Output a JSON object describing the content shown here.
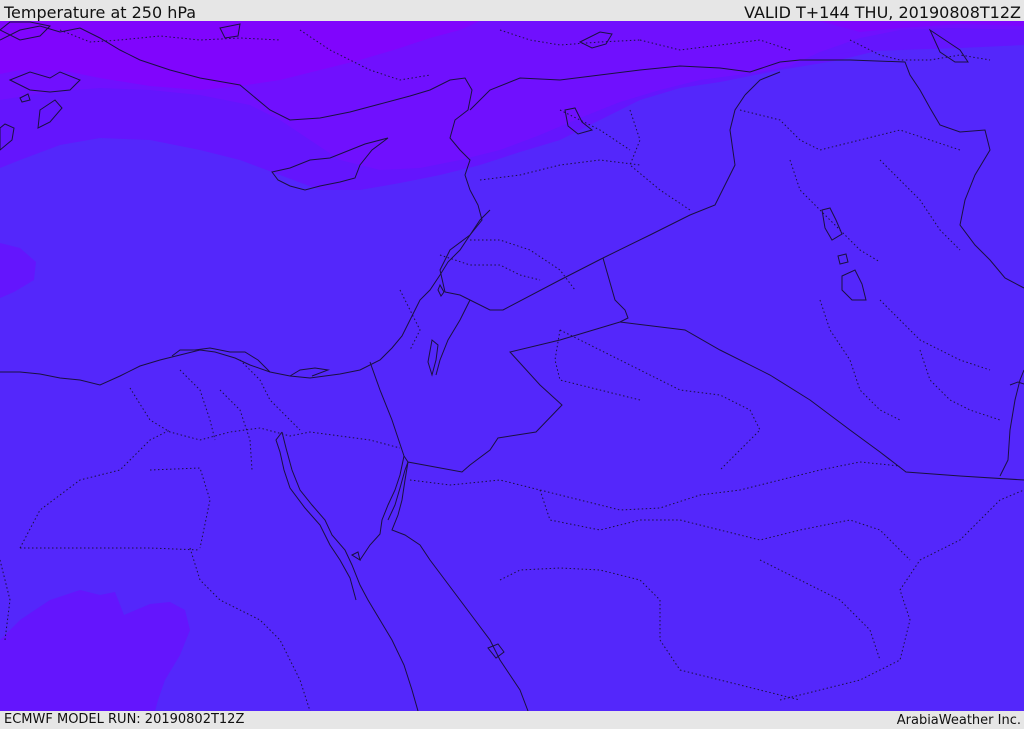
{
  "header": {
    "title": "Temperature at 250 hPa",
    "valid": "VALID T+144 THU, 20190808T12Z"
  },
  "footer": {
    "model_run": "ECMWF MODEL RUN: 20190802T12Z",
    "credit": "ArabiaWeather Inc."
  },
  "colors": {
    "base_fill": "#5427fb",
    "band_1": "#6415fd",
    "band_2": "#7010fe",
    "band_3": "#8005fd",
    "bars": "#e6e6e6",
    "lines": "#1a1040"
  }
}
